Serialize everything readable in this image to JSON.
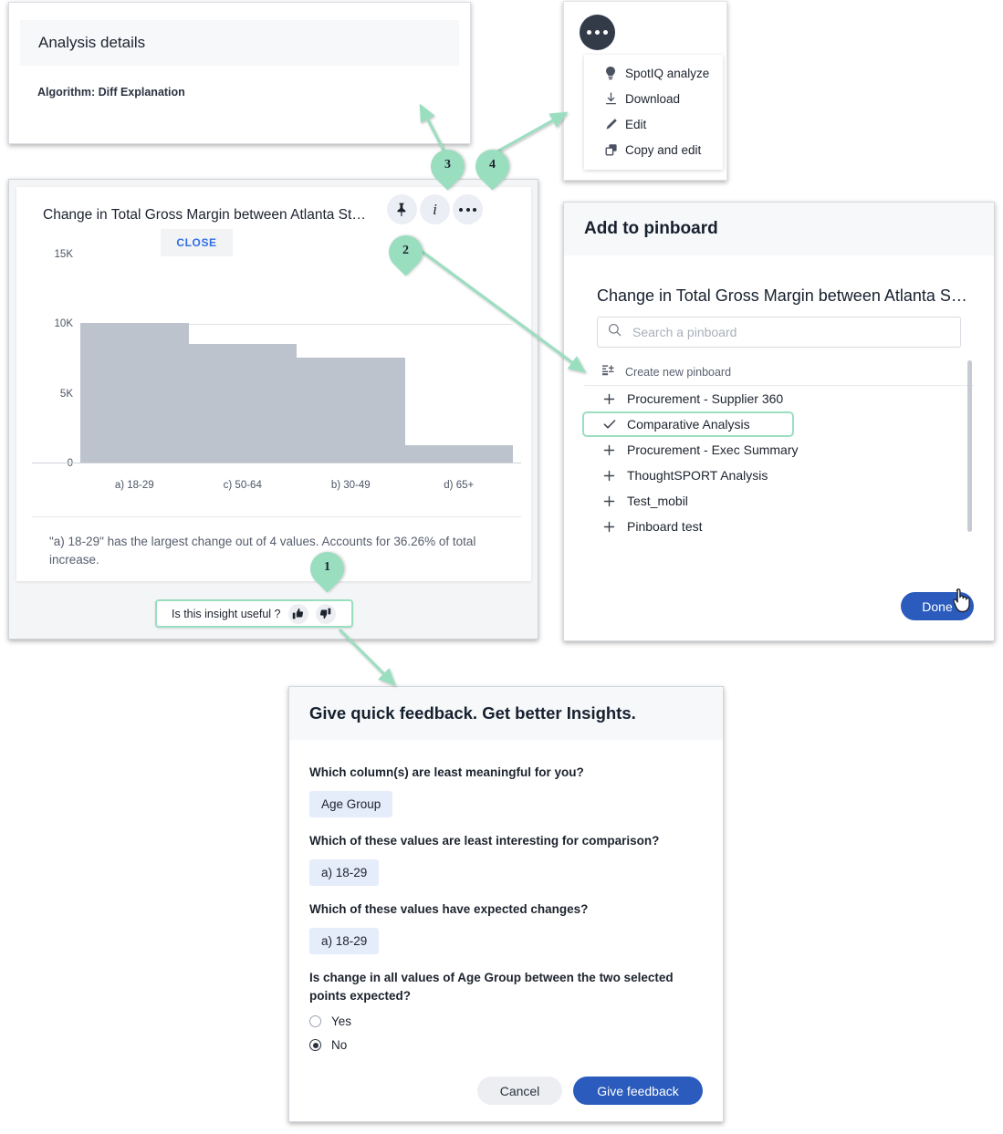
{
  "analysis_details": {
    "title": "Analysis details",
    "algorithm": "Algorithm: Diff Explanation"
  },
  "more_menu": {
    "trigger_icon": "ellipsis-icon",
    "items": [
      {
        "label": "SpotIQ analyze",
        "icon": "lightbulb-icon"
      },
      {
        "label": "Download",
        "icon": "download-icon"
      },
      {
        "label": "Edit",
        "icon": "pencil-icon"
      },
      {
        "label": "Copy and edit",
        "icon": "copy-icon"
      }
    ]
  },
  "chart_card": {
    "title": "Change in Total Gross Margin between Atlanta St…",
    "close_label": "CLOSE",
    "header_icons": [
      "pin-icon",
      "info-icon",
      "ellipsis-icon"
    ],
    "insight_text": "\"a) 18-29\" has the largest change out of 4 values. Accounts for 36.26% of total increase.",
    "useful_label": "Is this insight useful ?",
    "thumb_up_icon": "thumbs-up-icon",
    "thumb_down_icon": "thumbs-down-icon"
  },
  "chart_data": {
    "type": "bar",
    "title": "Change in Total Gross Margin between Atlanta St…",
    "xlabel": "",
    "ylabel": "",
    "categories": [
      "a) 18-29",
      "c) 50-64",
      "b) 30-49",
      "d) 65+"
    ],
    "values": [
      10100,
      8600,
      7600,
      1300
    ],
    "ylim": [
      0,
      15000
    ],
    "yticks": [
      "0",
      "5K",
      "10K",
      "15K"
    ],
    "ytick_values": [
      0,
      5000,
      10000,
      15000
    ],
    "grid": true,
    "legend": "none",
    "bar_color": "#bcc3cd"
  },
  "pinboard": {
    "header": "Add to pinboard",
    "subject": "Change in Total Gross Margin between Atlanta S…",
    "search_placeholder": "Search a pinboard",
    "search_value": "",
    "search_icon": "search-icon",
    "create_label": "Create new pinboard",
    "create_icon": "create-pinboard-icon",
    "items": [
      {
        "label": "Procurement - Supplier 360",
        "selected": false
      },
      {
        "label": "Comparative Analysis",
        "selected": true
      },
      {
        "label": "Procurement - Exec Summary",
        "selected": false
      },
      {
        "label": "ThoughtSPORT Analysis",
        "selected": false
      },
      {
        "label": "Test_mobil",
        "selected": false
      },
      {
        "label": "Pinboard test",
        "selected": false
      }
    ],
    "done_label": "Done"
  },
  "feedback": {
    "header": "Give quick feedback. Get better Insights.",
    "questions": [
      {
        "q": "Which column(s) are least meaningful for you?",
        "chip": "Age Group"
      },
      {
        "q": "Which of these values are least interesting for comparison?",
        "chip": "a) 18-29"
      },
      {
        "q": "Which of these values have expected changes?",
        "chip": "a) 18-29"
      }
    ],
    "radio_question": "Is change in all values of Age Group between the two selected points expected?",
    "radio_options": [
      {
        "label": "Yes",
        "selected": false
      },
      {
        "label": "No",
        "selected": true
      }
    ],
    "cancel_label": "Cancel",
    "submit_label": "Give feedback"
  },
  "callouts": [
    {
      "number": "1"
    },
    {
      "number": "2"
    },
    {
      "number": "3"
    },
    {
      "number": "4"
    }
  ],
  "colors": {
    "accent_green": "#9adec0",
    "primary_blue": "#2a5bbd",
    "link_blue": "#2f6fe4",
    "bar_gray": "#bcc3cd"
  }
}
